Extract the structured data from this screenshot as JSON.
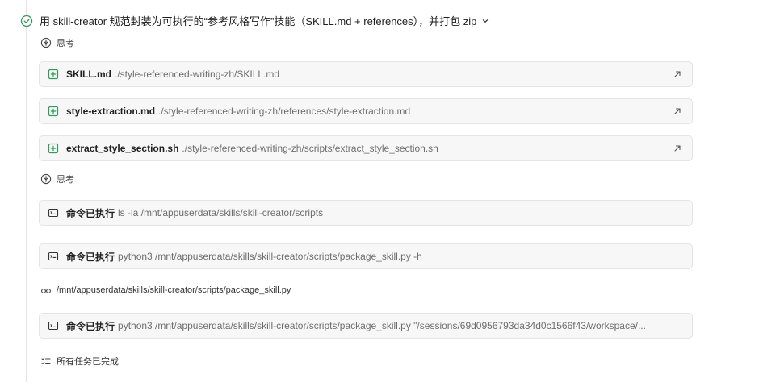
{
  "task": {
    "title": "用 skill-creator 规范封装为可执行的“参考风格写作”技能（SKILL.md + references），并打包 zip",
    "status_icon": "check-circle-icon",
    "accent_color": "#2e9a5b"
  },
  "thinking_label_1": "思考",
  "thinking_label_2": "思考",
  "files": [
    {
      "name": "SKILL.md",
      "path": "./style-referenced-writing-zh/SKILL.md"
    },
    {
      "name": "style-extraction.md",
      "path": "./style-referenced-writing-zh/references/style-extraction.md"
    },
    {
      "name": "extract_style_section.sh",
      "path": "./style-referenced-writing-zh/scripts/extract_style_section.sh"
    }
  ],
  "commands": [
    {
      "label": "命令已执行",
      "cmd": "ls -la /mnt/appuserdata/skills/skill-creator/scripts"
    },
    {
      "label": "命令已执行",
      "cmd": "python3 /mnt/appuserdata/skills/skill-creator/scripts/package_skill.py -h"
    },
    {
      "label": "命令已执行",
      "cmd": "python3 /mnt/appuserdata/skills/skill-creator/scripts/package_skill.py \"/sessions/69d0956793da34d0c1566f43/workspace/..."
    }
  ],
  "view_file": {
    "path": "/mnt/appuserdata/skills/skill-creator/scripts/package_skill.py"
  },
  "completion": {
    "label": "所有任务已完成"
  }
}
